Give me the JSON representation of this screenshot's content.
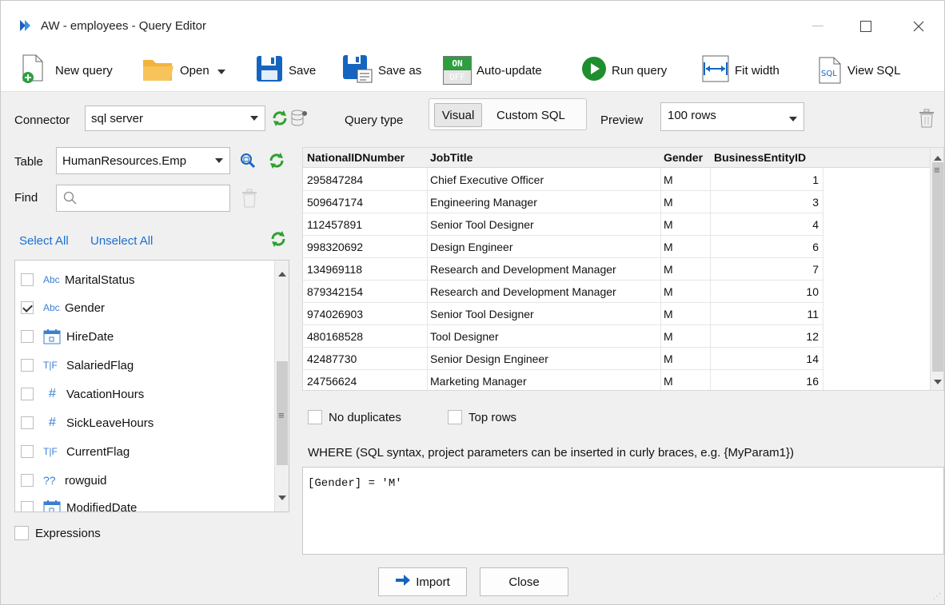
{
  "window": {
    "title": "AW - employees - Query Editor"
  },
  "toolbar": {
    "new_query": "New query",
    "open": "Open",
    "save": "Save",
    "save_as": "Save as",
    "auto_update": "Auto-update",
    "auto_update_on": "ON",
    "auto_update_off": "OFF",
    "run_query": "Run query",
    "fit_width": "Fit width",
    "view_sql": "View SQL",
    "view_sql_icon_text": "SQL"
  },
  "connector": {
    "label": "Connector",
    "value": "sql server"
  },
  "query_type": {
    "label": "Query type",
    "visual": "Visual",
    "custom_sql": "Custom SQL",
    "selected": "Visual"
  },
  "preview": {
    "label": "Preview",
    "value": "100 rows"
  },
  "table": {
    "label": "Table",
    "value": "HumanResources.Emp"
  },
  "find": {
    "label": "Find",
    "placeholder": ""
  },
  "selection": {
    "select_all": "Select All",
    "unselect_all": "Unselect All"
  },
  "fields": [
    {
      "icon": "Abc",
      "name": "MaritalStatus",
      "checked": false
    },
    {
      "icon": "Abc",
      "name": "Gender",
      "checked": true
    },
    {
      "icon": "calendar",
      "name": "HireDate",
      "checked": false
    },
    {
      "icon": "T|F",
      "name": "SalariedFlag",
      "checked": false
    },
    {
      "icon": "#",
      "name": "VacationHours",
      "checked": false
    },
    {
      "icon": "#",
      "name": "SickLeaveHours",
      "checked": false
    },
    {
      "icon": "T|F",
      "name": "CurrentFlag",
      "checked": false
    },
    {
      "icon": "??",
      "name": "rowguid",
      "checked": false
    },
    {
      "icon": "calendar",
      "name": "ModifiedDate",
      "checked": false
    }
  ],
  "expressions": {
    "label": "Expressions",
    "checked": false
  },
  "grid": {
    "columns": [
      "NationalIDNumber",
      "JobTitle",
      "Gender",
      "BusinessEntityID"
    ],
    "rows": [
      [
        "295847284",
        "Chief Executive Officer",
        "M",
        "1"
      ],
      [
        "509647174",
        "Engineering Manager",
        "M",
        "3"
      ],
      [
        "112457891",
        "Senior Tool Designer",
        "M",
        "4"
      ],
      [
        "998320692",
        "Design Engineer",
        "M",
        "6"
      ],
      [
        "134969118",
        "Research and Development Manager",
        "M",
        "7"
      ],
      [
        "879342154",
        "Research and Development Manager",
        "M",
        "10"
      ],
      [
        "974026903",
        "Senior Tool Designer",
        "M",
        "11"
      ],
      [
        "480168528",
        "Tool Designer",
        "M",
        "12"
      ],
      [
        "42487730",
        "Senior Design Engineer",
        "M",
        "14"
      ],
      [
        "24756624",
        "Marketing Manager",
        "M",
        "16"
      ]
    ]
  },
  "options": {
    "no_duplicates": "No duplicates",
    "top_rows": "Top rows"
  },
  "where": {
    "label": "WHERE (SQL syntax, project parameters can be inserted in curly braces, e.g. {MyParam1})",
    "value": "[Gender] = 'M'"
  },
  "buttons": {
    "import": "Import",
    "close": "Close"
  },
  "colors": {
    "accent_blue": "#1a6fd0",
    "refresh_green": "#2ea12e",
    "run_green": "#1e8e2e",
    "folder_orange": "#f5a623"
  }
}
